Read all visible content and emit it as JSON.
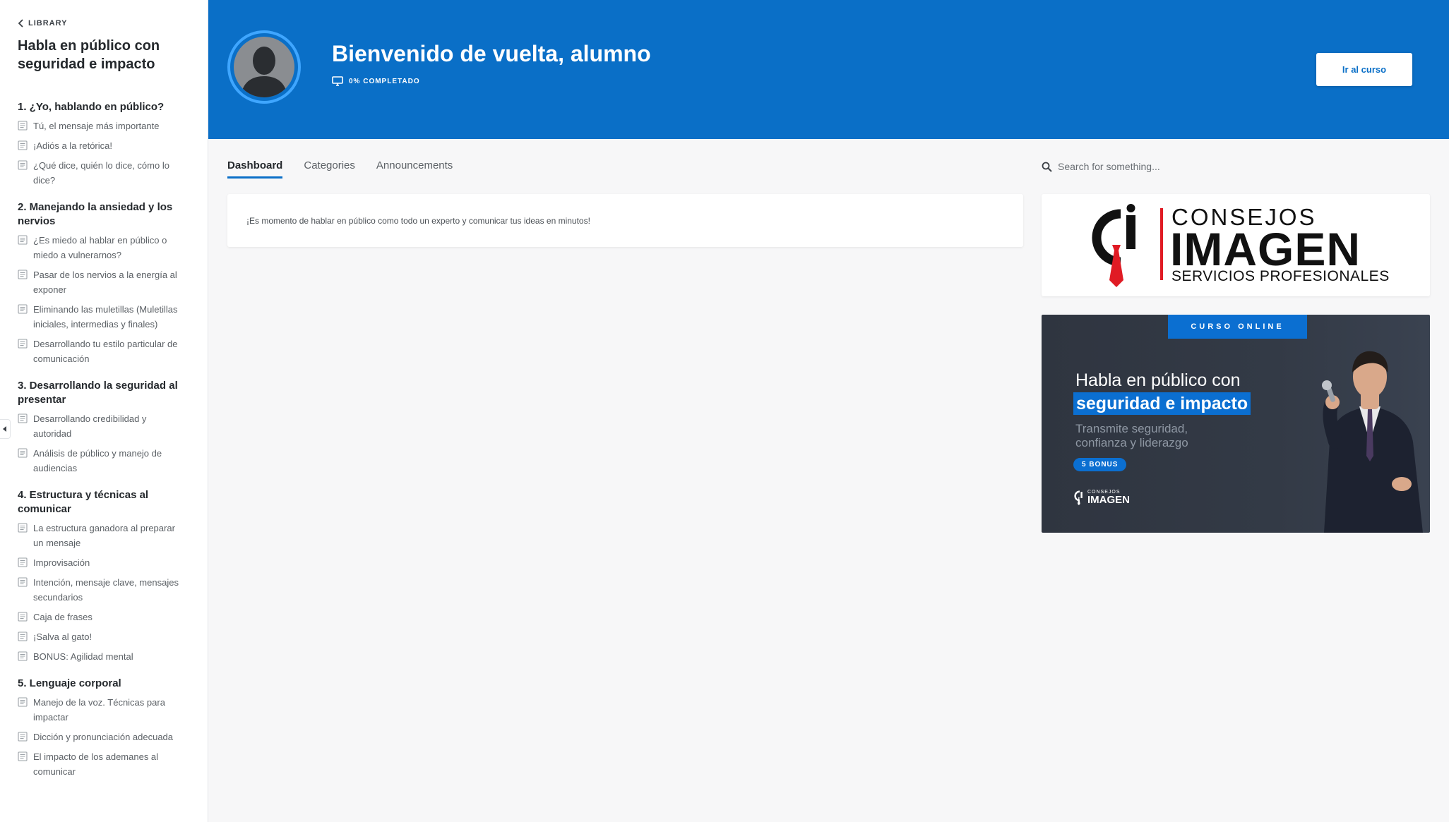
{
  "sidebar": {
    "back_label": "LIBRARY",
    "course_title": "Habla en público con seguridad e impacto",
    "sections": [
      {
        "title": "1. ¿Yo, hablando en público?",
        "lessons": [
          "Tú, el mensaje más importante",
          "¡Adiós a la retórica!",
          "¿Qué dice, quién lo dice, cómo lo dice?"
        ]
      },
      {
        "title": "2. Manejando la ansiedad y los nervios",
        "lessons": [
          "¿Es miedo al hablar en público o miedo a vulnerarnos?",
          "Pasar de los nervios a la energía al exponer",
          "Eliminando las muletillas (Muletillas iniciales, intermedias y finales)",
          "Desarrollando tu estilo particular de comunicación"
        ]
      },
      {
        "title": "3. Desarrollando la seguridad al presentar",
        "lessons": [
          "Desarrollando credibilidad y autoridad",
          "Análisis de público y manejo de audiencias"
        ]
      },
      {
        "title": "4. Estructura y técnicas al comunicar",
        "lessons": [
          "La estructura ganadora al preparar un mensaje",
          "Improvisación",
          "Intención, mensaje clave, mensajes secundarios",
          "Caja de frases",
          "¡Salva al gato!",
          "BONUS: Agilidad mental"
        ]
      },
      {
        "title": "5. Lenguaje corporal",
        "lessons": [
          "Manejo de la voz. Técnicas para impactar",
          "Dicción y pronunciación adecuada",
          "El impacto de los ademanes al comunicar"
        ]
      }
    ]
  },
  "header": {
    "welcome": "Bienvenido de vuelta, alumno",
    "progress_label": "0% COMPLETADO",
    "progress_percent": 0,
    "cta_label": "Ir al curso",
    "background_color": "#0a6fc7"
  },
  "tabs": [
    {
      "label": "Dashboard",
      "active": true
    },
    {
      "label": "Categories",
      "active": false
    },
    {
      "label": "Announcements",
      "active": false
    }
  ],
  "search": {
    "placeholder": "Search for something..."
  },
  "intro_card": {
    "text": "¡Es momento de hablar en público como todo un experto y comunicar tus ideas en minutos!"
  },
  "logo_card": {
    "top": "CONSEJOS",
    "main": "IMAGEN",
    "sub": "SERVICIOS PROFESIONALES"
  },
  "promo": {
    "tag": "CURSO ONLINE",
    "title_line1": "Habla en público con",
    "title_line2": "seguridad e impacto",
    "subtitle": "Transmite seguridad, confianza y liderazgo",
    "bonus": "5 BONUS",
    "logo_top": "CONSEJOS",
    "logo_main": "IMAGEN"
  },
  "colors": {
    "accent": "#0a6fc7",
    "logo_red": "#e01b24",
    "promo_bg": "#333a46"
  },
  "icons": {
    "back": "chevron-left-icon",
    "lesson": "document-icon",
    "progress": "monitor-icon",
    "search": "search-icon",
    "collapse": "caret-left-icon"
  }
}
